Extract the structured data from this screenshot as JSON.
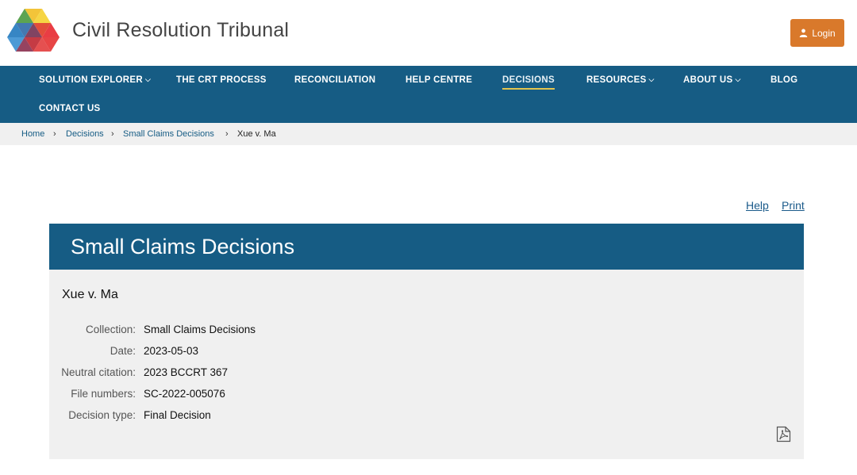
{
  "header": {
    "site_title": "Civil Resolution Tribunal",
    "login_label": "Login",
    "login_icon": "user-icon",
    "colors": {
      "login_bg": "#d9792b",
      "nav_bg": "#165c84"
    }
  },
  "nav": {
    "items": [
      {
        "label": "SOLUTION EXPLORER",
        "has_dropdown": true
      },
      {
        "label": "THE CRT PROCESS",
        "has_dropdown": false
      },
      {
        "label": "RECONCILIATION",
        "has_dropdown": false
      },
      {
        "label": "HELP CENTRE",
        "has_dropdown": false
      },
      {
        "label": "DECISIONS",
        "has_dropdown": false,
        "active": true
      },
      {
        "label": "RESOURCES",
        "has_dropdown": true
      },
      {
        "label": "ABOUT US",
        "has_dropdown": true
      },
      {
        "label": "BLOG",
        "has_dropdown": false
      },
      {
        "label": "CONTACT US",
        "has_dropdown": false
      }
    ],
    "dropdown_glyph": "⌵"
  },
  "breadcrumb": {
    "items": [
      "Home",
      "Decisions",
      "Small Claims Decisions",
      "Xue v. Ma"
    ],
    "separator": "›"
  },
  "utility": {
    "help_label": "Help",
    "print_label": "Print"
  },
  "panel": {
    "title": "Small Claims Decisions",
    "case_name": "Xue v. Ma",
    "fields": [
      {
        "label": "Collection:",
        "value": "Small Claims Decisions"
      },
      {
        "label": "Date:",
        "value": "2023-05-03"
      },
      {
        "label": "Neutral citation:",
        "value": "2023 BCCRT 367"
      },
      {
        "label": "File numbers:",
        "value": "SC-2022-005076"
      },
      {
        "label": "Decision type:",
        "value": "Final Decision"
      }
    ],
    "download_icon": "pdf-icon"
  }
}
